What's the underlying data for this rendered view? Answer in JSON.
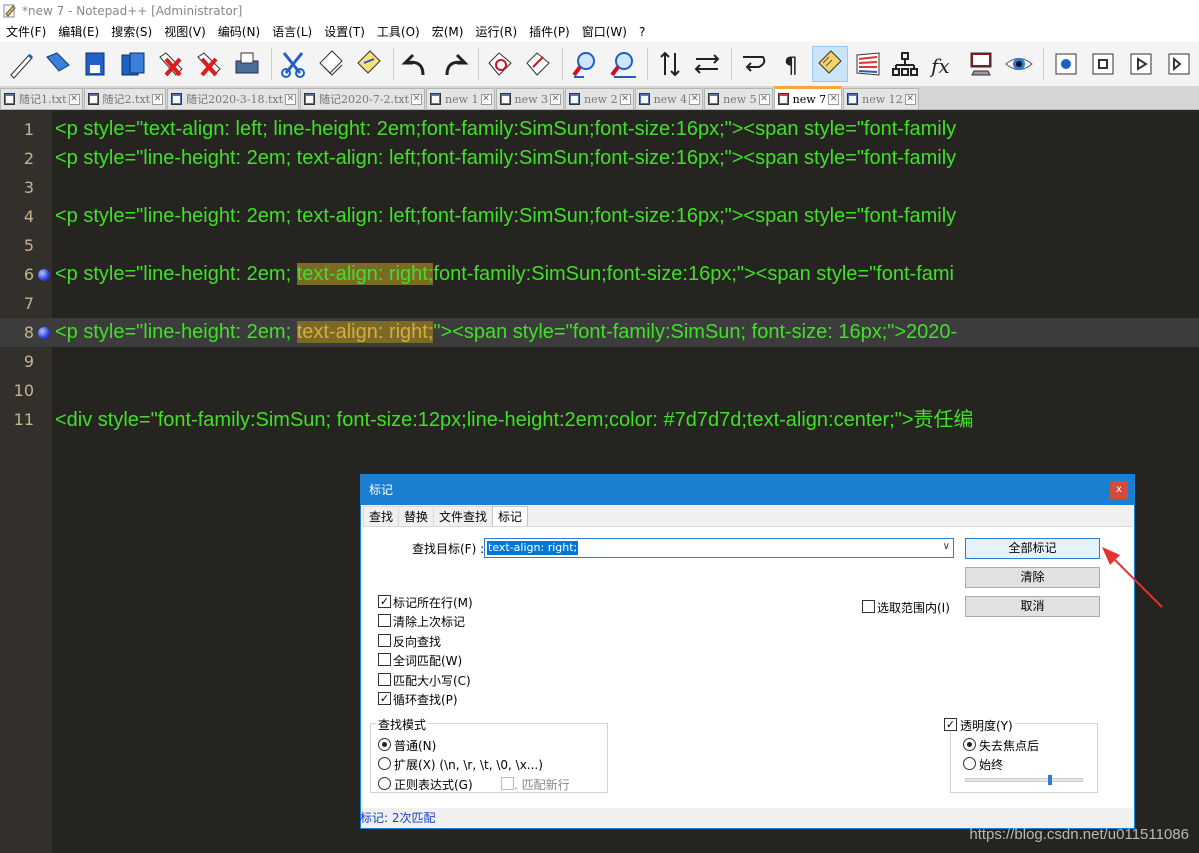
{
  "window": {
    "title": "*new 7 - Notepad++ [Administrator]"
  },
  "menu": [
    "文件(F)",
    "编辑(E)",
    "搜索(S)",
    "视图(V)",
    "编码(N)",
    "语言(L)",
    "设置(T)",
    "工具(O)",
    "宏(M)",
    "运行(R)",
    "插件(P)",
    "窗口(W)",
    "?"
  ],
  "toolbar_icons": [
    "new-file-icon",
    "open-file-icon",
    "save-icon",
    "save-all-icon",
    "close-icon",
    "close-all-icon",
    "print-icon",
    "cut-icon",
    "copy-icon",
    "paste-icon",
    "undo-icon",
    "redo-icon",
    "find-icon",
    "replace-icon",
    "zoom-in-icon",
    "zoom-out-icon",
    "sync-vertical-icon",
    "sync-horizontal-icon",
    "word-wrap-icon",
    "show-all-chars-icon",
    "indent-guide-icon",
    "doc-map-icon",
    "function-list-icon",
    "fx-icon",
    "monitor-icon",
    "eye-icon",
    "record-macro-icon",
    "stop-macro-icon",
    "play-macro-icon",
    "run-macro-multiple-icon"
  ],
  "tabs": [
    {
      "label": "随记1.txt",
      "active": false
    },
    {
      "label": "随记2.txt",
      "active": false
    },
    {
      "label": "随记2020-3-18.txt",
      "active": false
    },
    {
      "label": "随记2020-7-2.txt",
      "active": false
    },
    {
      "label": "new 1",
      "active": false
    },
    {
      "label": "new 3",
      "active": false
    },
    {
      "label": "new 2",
      "active": false
    },
    {
      "label": "new 4",
      "active": false
    },
    {
      "label": "new 5",
      "active": false
    },
    {
      "label": "new 7",
      "active": true
    },
    {
      "label": "new 12",
      "active": false
    }
  ],
  "editor": {
    "lines": [
      {
        "num": "1",
        "bookmark": false,
        "pre": "<p style=\"text-align: left; line-height: 2em;font-family:SimSun;font-size:16px;\"><span style=\"font-family",
        "match": "",
        "post": ""
      },
      {
        "num": "2",
        "bookmark": false,
        "pre": "<p style=\"line-height: 2em; text-align: left;font-family:SimSun;font-size:16px;\"><span style=\"font-family",
        "match": "",
        "post": ""
      },
      {
        "num": "3",
        "bookmark": false,
        "pre": "",
        "match": "",
        "post": ""
      },
      {
        "num": "4",
        "bookmark": false,
        "pre": "<p style=\"line-height: 2em; text-align: left;font-family:SimSun;font-size:16px;\"><span style=\"font-family",
        "match": "",
        "post": ""
      },
      {
        "num": "5",
        "bookmark": false,
        "pre": "",
        "match": "",
        "post": ""
      },
      {
        "num": "6",
        "bookmark": true,
        "pre": "<p style=\"line-height: 2em; ",
        "match": "text-align: right;",
        "post": "font-family:SimSun;font-size:16px;\"><span style=\"font-fami"
      },
      {
        "num": "7",
        "bookmark": false,
        "pre": "",
        "match": "",
        "post": ""
      },
      {
        "num": "8",
        "bookmark": true,
        "pre": "<p style=\"line-height: 2em; ",
        "match": "text-align: right;",
        "post": "\"><span style=\"font-family:SimSun; font-size: 16px;\">2020-"
      },
      {
        "num": "9",
        "bookmark": false,
        "pre": "",
        "match": "",
        "post": ""
      },
      {
        "num": "10",
        "bookmark": false,
        "pre": "",
        "match": "",
        "post": ""
      },
      {
        "num": "11",
        "bookmark": false,
        "pre": "<div style=\"font-family:SimSun; font-size:12px;line-height:2em;color: #7d7d7d;text-align:center;\">",
        "match": "",
        "post": "",
        "cjk": "责任编"
      }
    ]
  },
  "dialog": {
    "title": "标记",
    "close": "x",
    "tabs": [
      "查找",
      "替换",
      "文件查找",
      "标记"
    ],
    "active_tab": "标记",
    "find_label": "查找目标(F) :",
    "find_value": "text-align: right;",
    "buttons": {
      "mark_all": "全部标记",
      "clear": "清除",
      "cancel": "取消"
    },
    "options": [
      {
        "label": "标记所在行(M)",
        "checked": true
      },
      {
        "label": "清除上次标记",
        "checked": false
      },
      {
        "label": "反向查找",
        "checked": false
      },
      {
        "label": "全词匹配(W)",
        "checked": false
      },
      {
        "label": "匹配大小写(C)",
        "checked": false
      },
      {
        "label": "循环查找(P)",
        "checked": true
      }
    ],
    "in_selection": {
      "label": "选取范围内(I)",
      "checked": false
    },
    "search_mode": {
      "title": "查找模式",
      "normal": "普通(N)",
      "extended": "扩展(X) (\\n, \\r, \\t, \\0, \\x...)",
      "regex": "正则表达式(G)",
      "dot_newline": ". 匹配新行",
      "selected": "normal"
    },
    "transparency": {
      "label": "透明度(Y)",
      "checked": true,
      "on_lose_focus": "失去焦点后",
      "always": "始终",
      "selected": "on_lose_focus",
      "level": 0.72
    },
    "status": "标记: 2次匹配"
  },
  "watermark": "https://blog.csdn.net/u011511086",
  "colors": {
    "code": "#41e028",
    "highlight": "#7a6a25",
    "accent": "#1a7fd0",
    "arrow": "#e8322b"
  }
}
